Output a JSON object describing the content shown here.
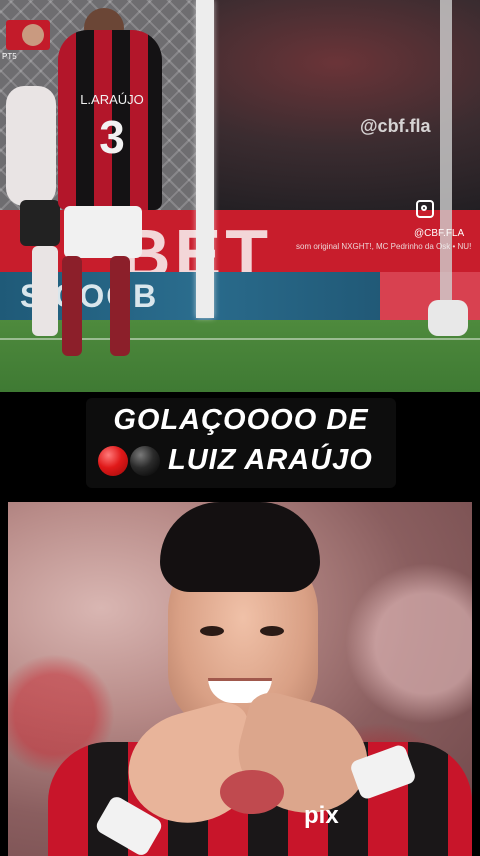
{
  "video": {
    "watermark": "@cbf.fla",
    "instagram_handle": "@CBF.FLA",
    "music_credit": "som original NXGHT!, MC Pedrinho da Osk • NU!",
    "score_label": "PT5",
    "adboard_main": "BET",
    "adboard_secondary": "SICOOB",
    "player_name": "L.ARAÚJO",
    "player_number": "3"
  },
  "caption": {
    "line1": "GOLAÇOOOO DE",
    "line2": "LUIZ ARAÚJO"
  },
  "photo": {
    "sponsor_text": "pix"
  },
  "colors": {
    "flamengo_red": "#c8152a",
    "flamengo_black": "#1a1718",
    "caption_bg": "#0d0d0d"
  }
}
